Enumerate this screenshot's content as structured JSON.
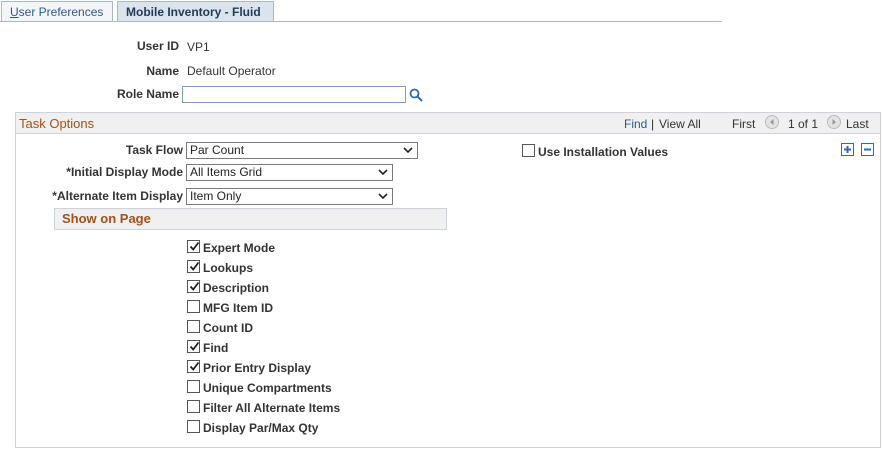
{
  "tabs": [
    {
      "label_u": "U",
      "label_rest": "ser Preferences"
    },
    {
      "label": "Mobile Inventory - Fluid"
    }
  ],
  "header": {
    "user_id_label": "User ID",
    "user_id_value": "VP1",
    "name_label": "Name",
    "name_value": "Default Operator",
    "role_name_label": "Role Name",
    "role_name_value": ""
  },
  "task_options": {
    "title": "Task Options",
    "nav": {
      "find": "Find",
      "separator": "|",
      "view_all": "View All",
      "first": "First",
      "count": "1 of 1",
      "last": "Last"
    },
    "task_flow_label": "Task Flow",
    "task_flow_value": "Par Count",
    "initial_display_label": "*Initial Display Mode",
    "initial_display_value": "All Items Grid",
    "alternate_item_label": "*Alternate Item Display",
    "alternate_item_value": "Item Only",
    "use_installation_label": "Use Installation Values",
    "use_installation_checked": false,
    "show_on_page_title": "Show on Page",
    "options": [
      {
        "label": "Expert Mode",
        "checked": true
      },
      {
        "label": "Lookups",
        "checked": true
      },
      {
        "label": "Description",
        "checked": true
      },
      {
        "label": "MFG Item ID",
        "checked": false
      },
      {
        "label": "Count ID",
        "checked": false
      },
      {
        "label": "Find",
        "checked": true
      },
      {
        "label": "Prior Entry Display",
        "checked": true
      },
      {
        "label": "Unique Compartments",
        "checked": false
      },
      {
        "label": "Filter All Alternate Items",
        "checked": false
      },
      {
        "label": "Display Par/Max Qty",
        "checked": false
      }
    ]
  },
  "icons": {
    "search": "search-icon",
    "prev": "previous-arrow-icon",
    "next": "next-arrow-icon",
    "add": "add-row-icon",
    "delete": "delete-row-icon",
    "dropdown": "chevron-down-icon",
    "check": "checkmark-icon"
  },
  "colors": {
    "section_title": "#a0521a",
    "link": "#2d5a87",
    "accent": "#2d6bb0"
  }
}
